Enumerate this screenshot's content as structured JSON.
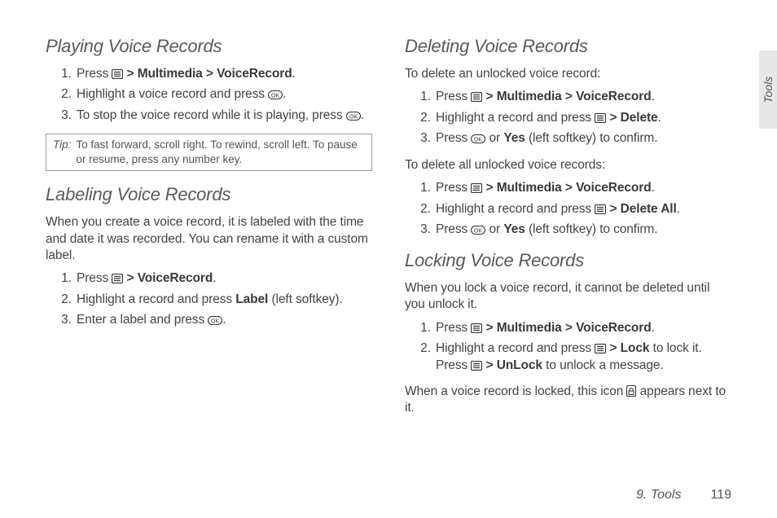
{
  "side_tab": "Tools",
  "footer": {
    "section": "9. Tools",
    "page": "119"
  },
  "left": {
    "h1": "Playing Voice Records",
    "s1": {
      "i1a": "Press ",
      "i1b": "Multimedia",
      "i1c": "VoiceRecord",
      "i2": "Highlight a voice record and press ",
      "i3a": "To stop the voice record while it is playing, press "
    },
    "tip_label": "Tip:",
    "tip_text": "To fast forward, scroll right. To rewind, scroll left. To pause or resume, press any number key.",
    "h2": "Labeling Voice Records",
    "p2": "When you create a voice record, it is labeled with the time and date it was recorded. You can rename it with a custom label.",
    "s2": {
      "i1a": "Press ",
      "i1b": "VoiceRecord",
      "i2a": "Highlight a record and press ",
      "i2b": "Label",
      "i2c": " (left softkey).",
      "i3a": "Enter a label and press "
    }
  },
  "right": {
    "h1": "Deleting Voice Records",
    "p1": "To delete an unlocked voice record:",
    "s1": {
      "i1a": "Press ",
      "i1b": "Multimedia",
      "i1c": "VoiceRecord",
      "i2a": "Highlight a record and press ",
      "i2b": "Delete",
      "i3a": "Press ",
      "i3b": " or ",
      "i3c": "Yes",
      "i3d": " (left softkey) to confirm."
    },
    "p2": "To delete all unlocked voice records:",
    "s2": {
      "i1a": "Press ",
      "i1b": "Multimedia",
      "i1c": "VoiceRecord",
      "i2a": "Highlight a record and press ",
      "i2b": "Delete All",
      "i3a": "Press ",
      "i3b": " or ",
      "i3c": "Yes",
      "i3d": " (left softkey) to confirm."
    },
    "h2": "Locking Voice Records",
    "p3": "When you lock a voice record, it cannot be deleted until you unlock it.",
    "s3": {
      "i1a": "Press ",
      "i1b": "Multimedia",
      "i1c": "VoiceRecord",
      "i2a": "Highlight a record and press ",
      "i2b": "Lock",
      "i2c": " to lock it. Press ",
      "i2d": "UnLock",
      "i2e": " to unlock a message."
    },
    "p4a": "When a voice record is locked, this icon ",
    "p4b": " appears next to it."
  }
}
